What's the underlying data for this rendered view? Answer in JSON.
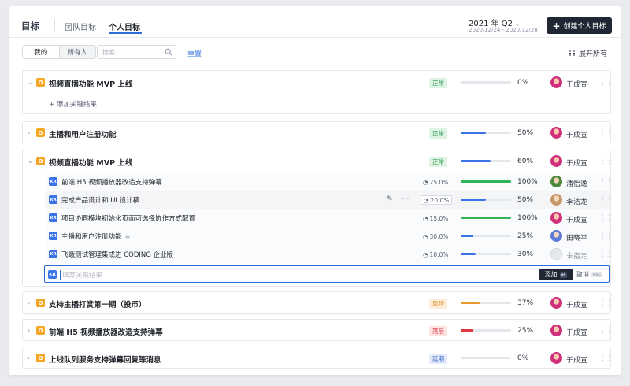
{
  "header": {
    "title": "目标",
    "tabs": [
      {
        "label": "团队目标"
      },
      {
        "label": "个人目标"
      }
    ],
    "period": "2021 年 Q2",
    "range": "2020/12/24 - 2020/12/28",
    "create_label": "创建个人目标"
  },
  "toolbar": {
    "filter_mine": "我的",
    "filter_all": "所有人",
    "search_placeholder": "搜索...",
    "reset_label": "重置",
    "expand_label": "展开所有"
  },
  "objectives": [
    {
      "badge": "O",
      "title": "视频直播功能 MVP 上线",
      "status": "正常",
      "progress": 0,
      "pct": "0%",
      "owner": "于成宣",
      "add_kr": "添加关键结果"
    },
    {
      "badge": "O",
      "title": "主播和用户注册功能",
      "status": "正常",
      "progress": 50,
      "pct": "50%",
      "owner": "于成宣"
    },
    {
      "badge": "O",
      "title": "视频直播功能 MVP 上线",
      "status": "正常",
      "progress": 60,
      "pct": "60%",
      "owner": "于成宣"
    },
    {
      "badge": "O",
      "title": "支持主播打赏第一期（投币）",
      "status": "风险",
      "progress": 37,
      "pct": "37%",
      "owner": "于成宣"
    },
    {
      "badge": "O",
      "title": "前端 H5 视频播放器改造支持弹幕",
      "status": "落后",
      "progress": 25,
      "pct": "25%",
      "owner": "于成宣"
    },
    {
      "badge": "O",
      "title": "上线队列服务支持弹幕回复等消息",
      "status": "延期",
      "progress": 0,
      "pct": "0%",
      "owner": "于成宣"
    }
  ],
  "key_results": [
    {
      "badge": "KR",
      "title": "前端 H5 视频播放器改造支持弹幕",
      "weight": "25.0%",
      "progress": 100,
      "pct": "100%",
      "owner": "潘怡逸"
    },
    {
      "badge": "KR",
      "title": "完成产品设计和 UI 设计稿",
      "weight": "20.0%",
      "progress": 50,
      "pct": "50%",
      "owner": "李浩龙"
    },
    {
      "badge": "KR",
      "title": "项目协同模块初始化页面可选择协作方式配置",
      "weight": "15.0%",
      "progress": 100,
      "pct": "100%",
      "owner": "于成宣"
    },
    {
      "badge": "KR",
      "title": "主播和用户注册功能",
      "weight": "30.0%",
      "progress": 25,
      "pct": "25%",
      "owner": "田晓平"
    },
    {
      "badge": "KR",
      "title": "飞蛾测试管理集成进 CODING 企业版",
      "weight": "10.0%",
      "progress": 30,
      "pct": "30%",
      "owner": "未指定"
    }
  ],
  "new_kr": {
    "badge": "KR",
    "placeholder": "填写关键结果",
    "add_label": "添加",
    "add_key": "↵",
    "cancel_label": "取消",
    "cancel_key": "esc"
  },
  "colors": {
    "brand": "#2b6cd6",
    "progress_blue": "#3a72e8",
    "progress_green": "#2fb556",
    "progress_orange": "#e89a2c",
    "progress_red": "#e0383e",
    "objective_badge": "#f5a623"
  }
}
